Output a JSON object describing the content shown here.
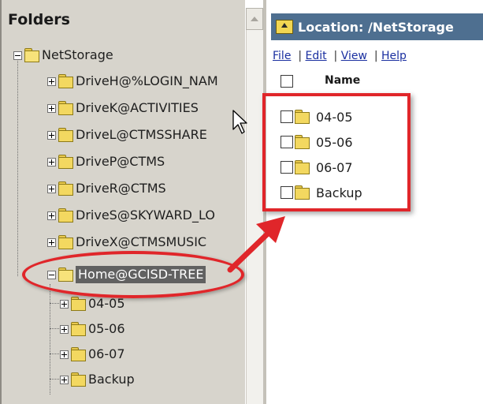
{
  "left_pane": {
    "header": "Folders",
    "root": {
      "label": "NetStorage",
      "expanded": true
    },
    "drives": [
      {
        "label": "DriveH@%LOGIN_NAM"
      },
      {
        "label": "DriveK@ACTIVITIES"
      },
      {
        "label": "DriveL@CTMSSHARE"
      },
      {
        "label": "DriveP@CTMS"
      },
      {
        "label": "DriveR@CTMS"
      },
      {
        "label": "DriveS@SKYWARD_LO"
      },
      {
        "label": "DriveX@CTMSMUSIC"
      }
    ],
    "selected": {
      "label": "Home@GCISD-TREE",
      "expanded": true
    },
    "children": [
      {
        "label": "04-05"
      },
      {
        "label": "05-06"
      },
      {
        "label": "06-07"
      },
      {
        "label": "Backup"
      }
    ]
  },
  "right_pane": {
    "location": "Location: /NetStorage",
    "menu": {
      "file": "File",
      "edit": "Edit",
      "view": "View",
      "help": "Help",
      "separator": "|"
    },
    "column_name": "Name",
    "files": [
      {
        "label": "04-05"
      },
      {
        "label": "05-06"
      },
      {
        "label": "06-07"
      },
      {
        "label": "Backup"
      }
    ]
  },
  "colors": {
    "callout_red": "#e0262a",
    "location_bar": "#4e6f90",
    "tree_background": "#d7d4cc",
    "selection": "#616161",
    "folder_yellow": "#f3d860",
    "link_blue": "#1a2fa0"
  },
  "icons": {
    "expander_collapsed": "plus-box-icon",
    "expander_expanded": "minus-box-icon",
    "folder": "folder-icon",
    "folder_open": "folder-open-icon",
    "location": "up-folder-icon",
    "scroll": "scroll-up-arrow-icon",
    "pointer": "mouse-pointer-icon"
  }
}
